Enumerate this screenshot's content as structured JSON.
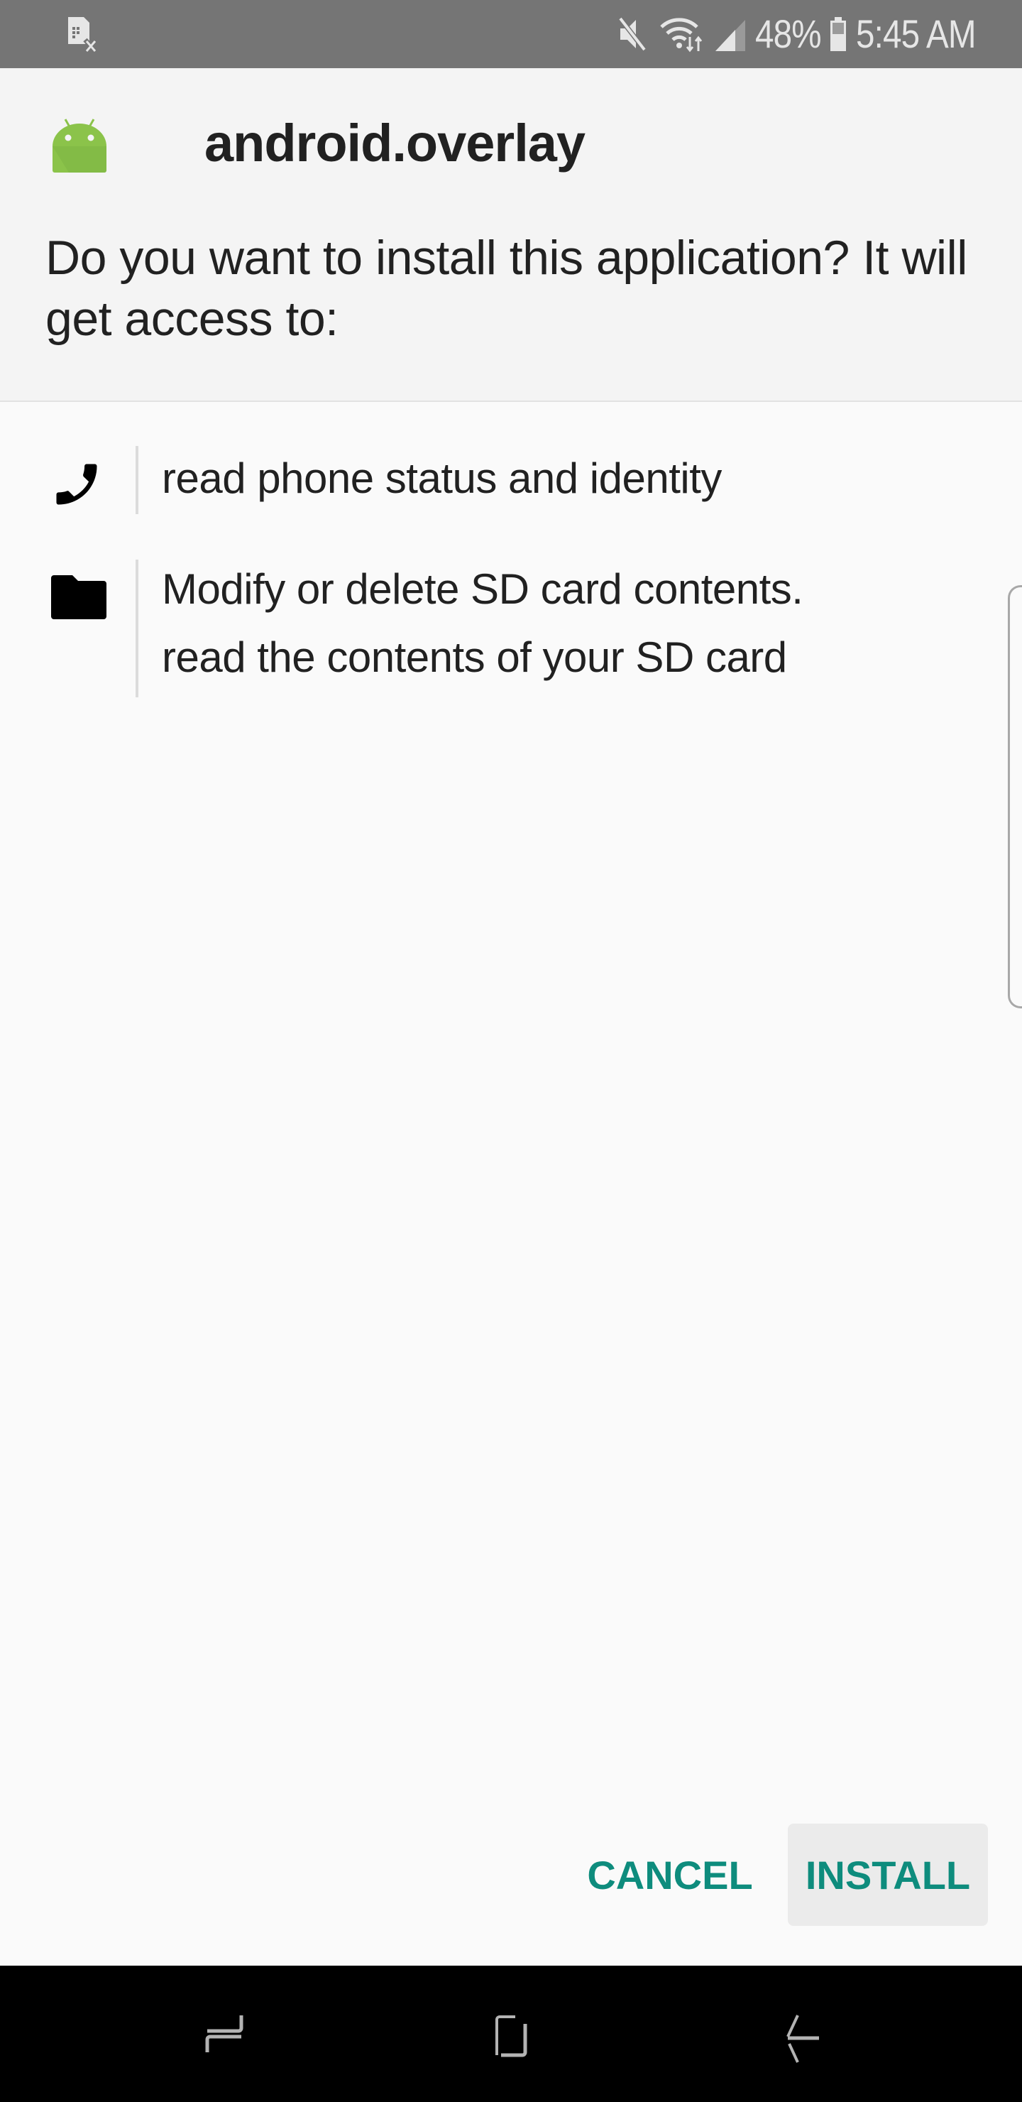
{
  "status_bar": {
    "left_icons": [
      "sim-card-error-icon"
    ],
    "right_icons": [
      "mute-icon",
      "wifi-icon",
      "signal-icon",
      "battery-icon"
    ],
    "battery_percent": "48%",
    "time": "5:45 AM"
  },
  "dialog": {
    "app_icon": "android-robot-icon",
    "app_name": "android.overlay",
    "question": "Do you want to install this application? It will get access to:",
    "permissions": [
      {
        "icon": "phone-icon",
        "lines": [
          "read phone status and identity"
        ]
      },
      {
        "icon": "folder-icon",
        "lines": [
          "Modify or delete SD card contents.",
          "read the contents of your SD card"
        ]
      }
    ],
    "buttons": {
      "cancel": "CANCEL",
      "install": "INSTALL"
    },
    "accent_color": "#0e8c7d"
  },
  "nav_bar": {
    "buttons": [
      "recent-apps-icon",
      "home-icon",
      "back-icon"
    ]
  }
}
